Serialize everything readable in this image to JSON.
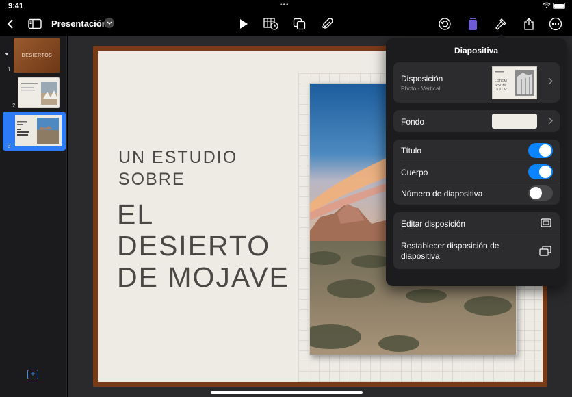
{
  "status_bar": {
    "time": "9:41"
  },
  "toolbar": {
    "document_title": "Presentación",
    "icons": [
      "back-icon",
      "sidebar-icon",
      "play-icon",
      "table-icon",
      "shapes-icon",
      "attachment-icon",
      "undo-icon",
      "format-icon",
      "hammer-icon",
      "share-icon",
      "more-icon"
    ]
  },
  "navigator": {
    "slides": [
      {
        "number": "1",
        "label": "DESIERTOS"
      },
      {
        "number": "2"
      },
      {
        "number": "3"
      }
    ]
  },
  "slide": {
    "subtitle": "UN ESTUDIO SOBRE",
    "title": "EL DESIERTO DE MOJAVE"
  },
  "popover": {
    "title": "Diapositiva",
    "layout_label": "Disposición",
    "layout_value": "Photo - Vertical",
    "layout_thumb_text": "LOREM IPSUM DOLOR",
    "background_label": "Fondo",
    "toggles": [
      {
        "label": "Título",
        "on": true
      },
      {
        "label": "Cuerpo",
        "on": true
      },
      {
        "label": "Número de diapositiva",
        "on": false
      }
    ],
    "edit_layout_label": "Editar disposición",
    "reset_layout_label": "Restablecer disposición de diapositiva"
  },
  "colors": {
    "accent": "#0a84ff",
    "slide_frame": "#7a3a16",
    "slide_bg": "#eeebe5"
  }
}
